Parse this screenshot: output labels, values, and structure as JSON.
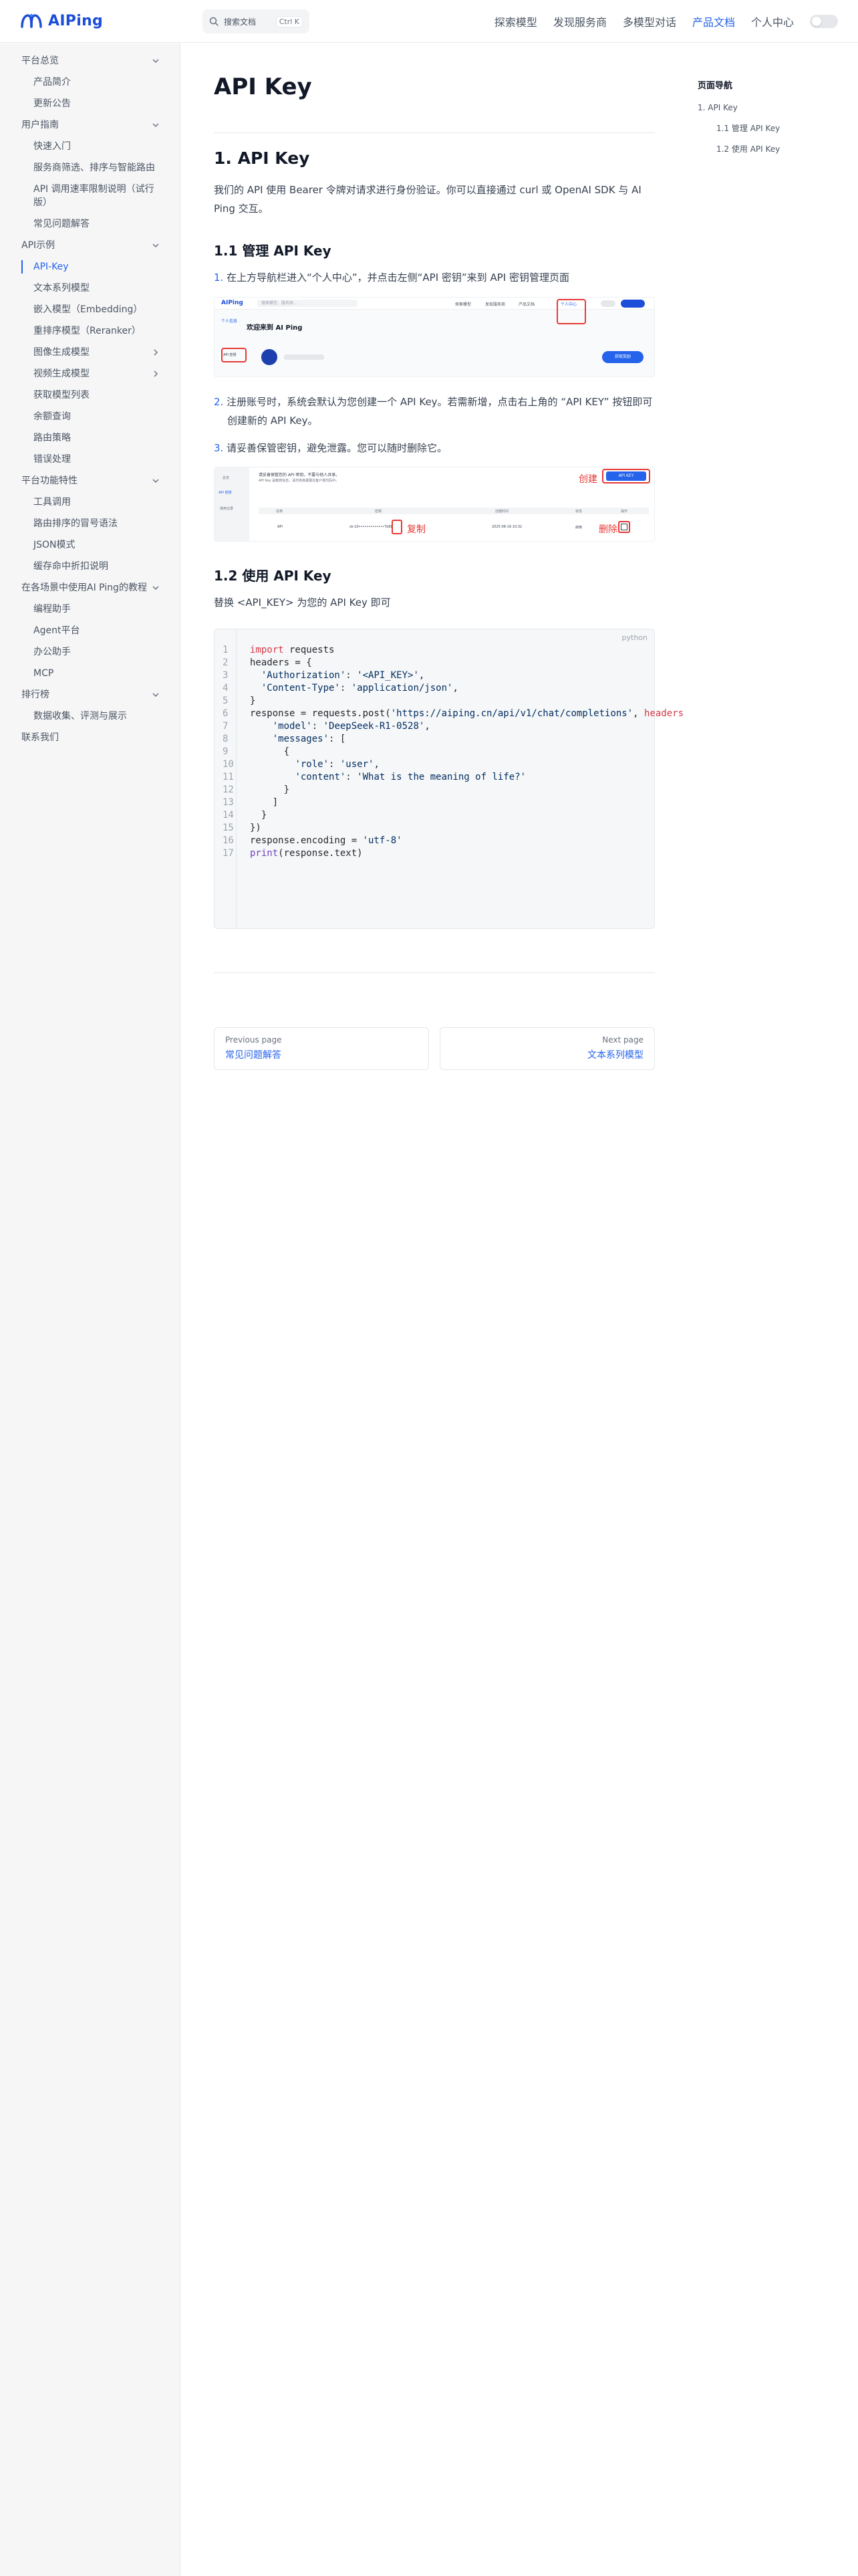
{
  "header": {
    "logo_text": "AIPing",
    "search_label": "搜索文档",
    "search_shortcut": "Ctrl K",
    "nav": [
      {
        "label": "探索模型",
        "active": false
      },
      {
        "label": "发现服务商",
        "active": false
      },
      {
        "label": "多模型对话",
        "active": false
      },
      {
        "label": "产品文档",
        "active": true
      },
      {
        "label": "个人中心",
        "active": false
      }
    ],
    "accent": "#2563eb"
  },
  "sidebar": {
    "items": [
      {
        "label": "平台总览",
        "level": 0,
        "chevron": "down"
      },
      {
        "label": "产品简介",
        "level": 1
      },
      {
        "label": "更新公告",
        "level": 1
      },
      {
        "label": "用户指南",
        "level": 0,
        "chevron": "down"
      },
      {
        "label": "快速入门",
        "level": 1
      },
      {
        "label": "服务商筛选、排序与智能路由",
        "level": 1
      },
      {
        "label": "API 调用速率限制说明（试行版）",
        "level": 1
      },
      {
        "label": "常见问题解答",
        "level": 1
      },
      {
        "label": "API示例",
        "level": 0,
        "chevron": "down"
      },
      {
        "label": "API-Key",
        "level": 1,
        "active": true
      },
      {
        "label": "文本系列模型",
        "level": 1
      },
      {
        "label": "嵌入模型（Embedding）",
        "level": 1
      },
      {
        "label": "重排序模型（Reranker）",
        "level": 1
      },
      {
        "label": "图像生成模型",
        "level": 1,
        "chevron": "right"
      },
      {
        "label": "视频生成模型",
        "level": 1,
        "chevron": "right"
      },
      {
        "label": "获取模型列表",
        "level": 1
      },
      {
        "label": "余额查询",
        "level": 1
      },
      {
        "label": "路由策略",
        "level": 1
      },
      {
        "label": "错误处理",
        "level": 1
      },
      {
        "label": "平台功能特性",
        "level": 0,
        "chevron": "down"
      },
      {
        "label": "工具调用",
        "level": 1
      },
      {
        "label": "路由排序的冒号语法",
        "level": 1
      },
      {
        "label": "JSON模式",
        "level": 1
      },
      {
        "label": "缓存命中折扣说明",
        "level": 1
      },
      {
        "label": "在各场景中使用AI Ping的教程",
        "level": 0,
        "chevron": "down"
      },
      {
        "label": "编程助手",
        "level": 1
      },
      {
        "label": "Agent平台",
        "level": 1
      },
      {
        "label": "办公助手",
        "level": 1
      },
      {
        "label": "MCP",
        "level": 1
      },
      {
        "label": "排行榜",
        "level": 0,
        "chevron": "down"
      },
      {
        "label": "数据收集、评测与展示",
        "level": 1
      },
      {
        "label": "联系我们",
        "level": 0
      }
    ]
  },
  "main": {
    "title": "API Key",
    "h2": "1. API Key",
    "intro": "我们的 API 使用 Bearer 令牌对请求进行身份验证。你可以直接通过 curl 或 OpenAI SDK 与 AI Ping 交互。",
    "h3_1": "1.1 管理 API Key",
    "steps": [
      {
        "num": "1.",
        "text": "在上方导航栏进入“个人中心”，并点击左侧“API 密钥”来到 API 密钥管理页面"
      },
      {
        "num": "2.",
        "text": "注册账号时，系统会默认为您创建一个 API Key。若需新增，点击右上角的 “API KEY” 按钮即可创建新的 API Key。"
      },
      {
        "num": "3.",
        "text": "请妥善保管密钥，避免泄露。您可以随时删除它。"
      }
    ],
    "shot1": {
      "logo": "AIPing",
      "search": "搜索模型、服务商…",
      "nav": [
        "探索模型",
        "发现服务商",
        "产品文档",
        "个人中心"
      ],
      "side": [
        "个人信息",
        "API 密钥"
      ],
      "welcome": "欢迎来到 AI Ping",
      "button": "获取奖励"
    },
    "shot2": {
      "notice_1": "请妥善保管您的 API 密钥，不要与他人共享。",
      "notice_2": "API Key 是敏感信息，请勿将其暴露在客户端代码中。",
      "button": "API KEY",
      "side": [
        "总览",
        "API 密钥",
        "使用记录"
      ],
      "cols": [
        "名称",
        "密钥",
        "创建时间",
        "状态",
        "操作"
      ],
      "row": [
        "API",
        "sk-10•••••••••••••7b6b",
        "2025-08-19 10:32",
        "启用"
      ],
      "ann_create": "创建",
      "ann_copy": "复制",
      "ann_delete": "删除"
    },
    "h3_2": "1.2 使用 API Key",
    "replace_text": "替换 <API_KEY> 为您的 API Key 即可",
    "code_lang": "python",
    "code_lines": [
      {
        "n": "1",
        "segments": [
          {
            "t": "import",
            "k": "kw"
          },
          {
            "t": " requests",
            "k": ""
          }
        ]
      },
      {
        "n": "2",
        "segments": [
          {
            "t": "headers = {",
            "k": ""
          }
        ]
      },
      {
        "n": "3",
        "segments": [
          {
            "t": "  ",
            "k": ""
          },
          {
            "t": "'Authorization'",
            "k": "str"
          },
          {
            "t": ": ",
            "k": ""
          },
          {
            "t": "'<API_KEY>'",
            "k": "str"
          },
          {
            "t": ",",
            "k": ""
          }
        ]
      },
      {
        "n": "4",
        "segments": [
          {
            "t": "  ",
            "k": ""
          },
          {
            "t": "'Content-Type'",
            "k": "str"
          },
          {
            "t": ": ",
            "k": ""
          },
          {
            "t": "'application/json'",
            "k": "str"
          },
          {
            "t": ",",
            "k": ""
          }
        ]
      },
      {
        "n": "5",
        "segments": [
          {
            "t": "}",
            "k": ""
          }
        ]
      },
      {
        "n": "6",
        "segments": [
          {
            "t": "response = requests.post(",
            "k": ""
          },
          {
            "t": "'https://aiping.cn/api/v1/chat/completions'",
            "k": "str"
          },
          {
            "t": ", ",
            "k": ""
          },
          {
            "t": "headers",
            "k": "kw"
          }
        ]
      },
      {
        "n": "7",
        "segments": [
          {
            "t": "    ",
            "k": ""
          },
          {
            "t": "'model'",
            "k": "str"
          },
          {
            "t": ": ",
            "k": ""
          },
          {
            "t": "'DeepSeek-R1-0528'",
            "k": "str"
          },
          {
            "t": ",",
            "k": ""
          }
        ]
      },
      {
        "n": "8",
        "segments": [
          {
            "t": "    ",
            "k": ""
          },
          {
            "t": "'messages'",
            "k": "str"
          },
          {
            "t": ": [",
            "k": ""
          }
        ]
      },
      {
        "n": "9",
        "segments": [
          {
            "t": "      {",
            "k": ""
          }
        ]
      },
      {
        "n": "10",
        "segments": [
          {
            "t": "        ",
            "k": ""
          },
          {
            "t": "'role'",
            "k": "str"
          },
          {
            "t": ": ",
            "k": ""
          },
          {
            "t": "'user'",
            "k": "str"
          },
          {
            "t": ",",
            "k": ""
          }
        ]
      },
      {
        "n": "11",
        "segments": [
          {
            "t": "        ",
            "k": ""
          },
          {
            "t": "'content'",
            "k": "str"
          },
          {
            "t": ": ",
            "k": ""
          },
          {
            "t": "'What is the meaning of life?'",
            "k": "str"
          }
        ]
      },
      {
        "n": "12",
        "segments": [
          {
            "t": "      }",
            "k": ""
          }
        ]
      },
      {
        "n": "13",
        "segments": [
          {
            "t": "    ]",
            "k": ""
          }
        ]
      },
      {
        "n": "14",
        "segments": [
          {
            "t": "  }",
            "k": ""
          }
        ]
      },
      {
        "n": "15",
        "segments": [
          {
            "t": "})",
            "k": ""
          }
        ]
      },
      {
        "n": "16",
        "segments": [
          {
            "t": "response.encoding = ",
            "k": ""
          },
          {
            "t": "'utf-8'",
            "k": "str"
          }
        ]
      },
      {
        "n": "17",
        "segments": [
          {
            "t": "print",
            "k": "fn"
          },
          {
            "t": "(response.text)",
            "k": ""
          }
        ]
      }
    ]
  },
  "pager": {
    "prev_label": "Previous page",
    "prev_link": "常见问题解答",
    "next_label": "Next page",
    "next_link": "文本系列模型"
  },
  "toc": {
    "title": "页面导航",
    "items": [
      {
        "label": "1. API Key",
        "level": 0
      },
      {
        "label": "1.1 管理 API Key",
        "level": 1
      },
      {
        "label": "1.2 使用 API Key",
        "level": 1
      }
    ]
  }
}
